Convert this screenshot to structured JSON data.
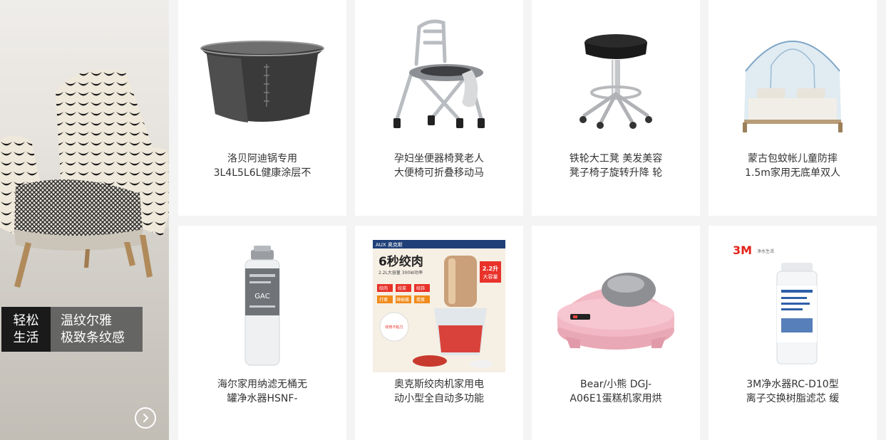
{
  "banner": {
    "tag_primary_line1": "轻松",
    "tag_primary_line2": "生活",
    "tag_secondary_line1": "温纹尔雅",
    "tag_secondary_line2": "极致条纹感",
    "more_icon": "chevron-right-circle-icon"
  },
  "products": [
    {
      "line1": "洛贝阿迪锅专用",
      "line2": "3L4L5L6L健康涂层不",
      "image": "rice-cooker-inner-pot"
    },
    {
      "line1": "孕妇坐便器椅凳老人",
      "line2": "大便椅可折叠移动马",
      "image": "folding-commode-chair"
    },
    {
      "line1": "铁轮大工凳 美发美容",
      "line2": "凳子椅子旋转升降 轮",
      "image": "salon-stool"
    },
    {
      "line1": "蒙古包蚊帐儿童防摔",
      "line2": "1.5m家用无底单双人",
      "image": "yurt-mosquito-net"
    },
    {
      "line1": "海尔家用纳滤无桶无",
      "line2": "罐净水器HSNF-",
      "image": "water-filter-cartridge"
    },
    {
      "line1": "奥克斯绞肉机家用电",
      "line2": "动小型全自动多功能",
      "image": "meat-grinder"
    },
    {
      "line1": "Bear/小熊 DGJ-",
      "line2": "A06E1蛋糕机家用烘",
      "image": "pink-cake-maker"
    },
    {
      "line1": "3M净水器RC-D10型",
      "line2": "离子交换树脂滤芯 缓",
      "image": "3m-filter-cartridge"
    }
  ],
  "image_text": {
    "aux_brand": "AUX 奥克斯",
    "aux_headline": "6秒绞肉",
    "aux_badge_line1": "2.2升",
    "aux_badge_line2": "大容量",
    "aux_sub": "2.2L大容量 300W功率",
    "aux_chips": [
      "绞肉",
      "绞菜",
      "绞蒜",
      "打蛋",
      "辣椒酱",
      "搅蛋"
    ],
    "aux_sticker": "绞肉不粘刀",
    "haier_filter_label": "GAC",
    "threem_logo": "3M",
    "threem_tagline": "净水生活"
  },
  "colors": {
    "page_bg": "#f4f4f4",
    "card_bg": "#ffffff",
    "text": "#333333",
    "aux_red": "#e8322a",
    "cake_pink": "#f2b8c4"
  }
}
